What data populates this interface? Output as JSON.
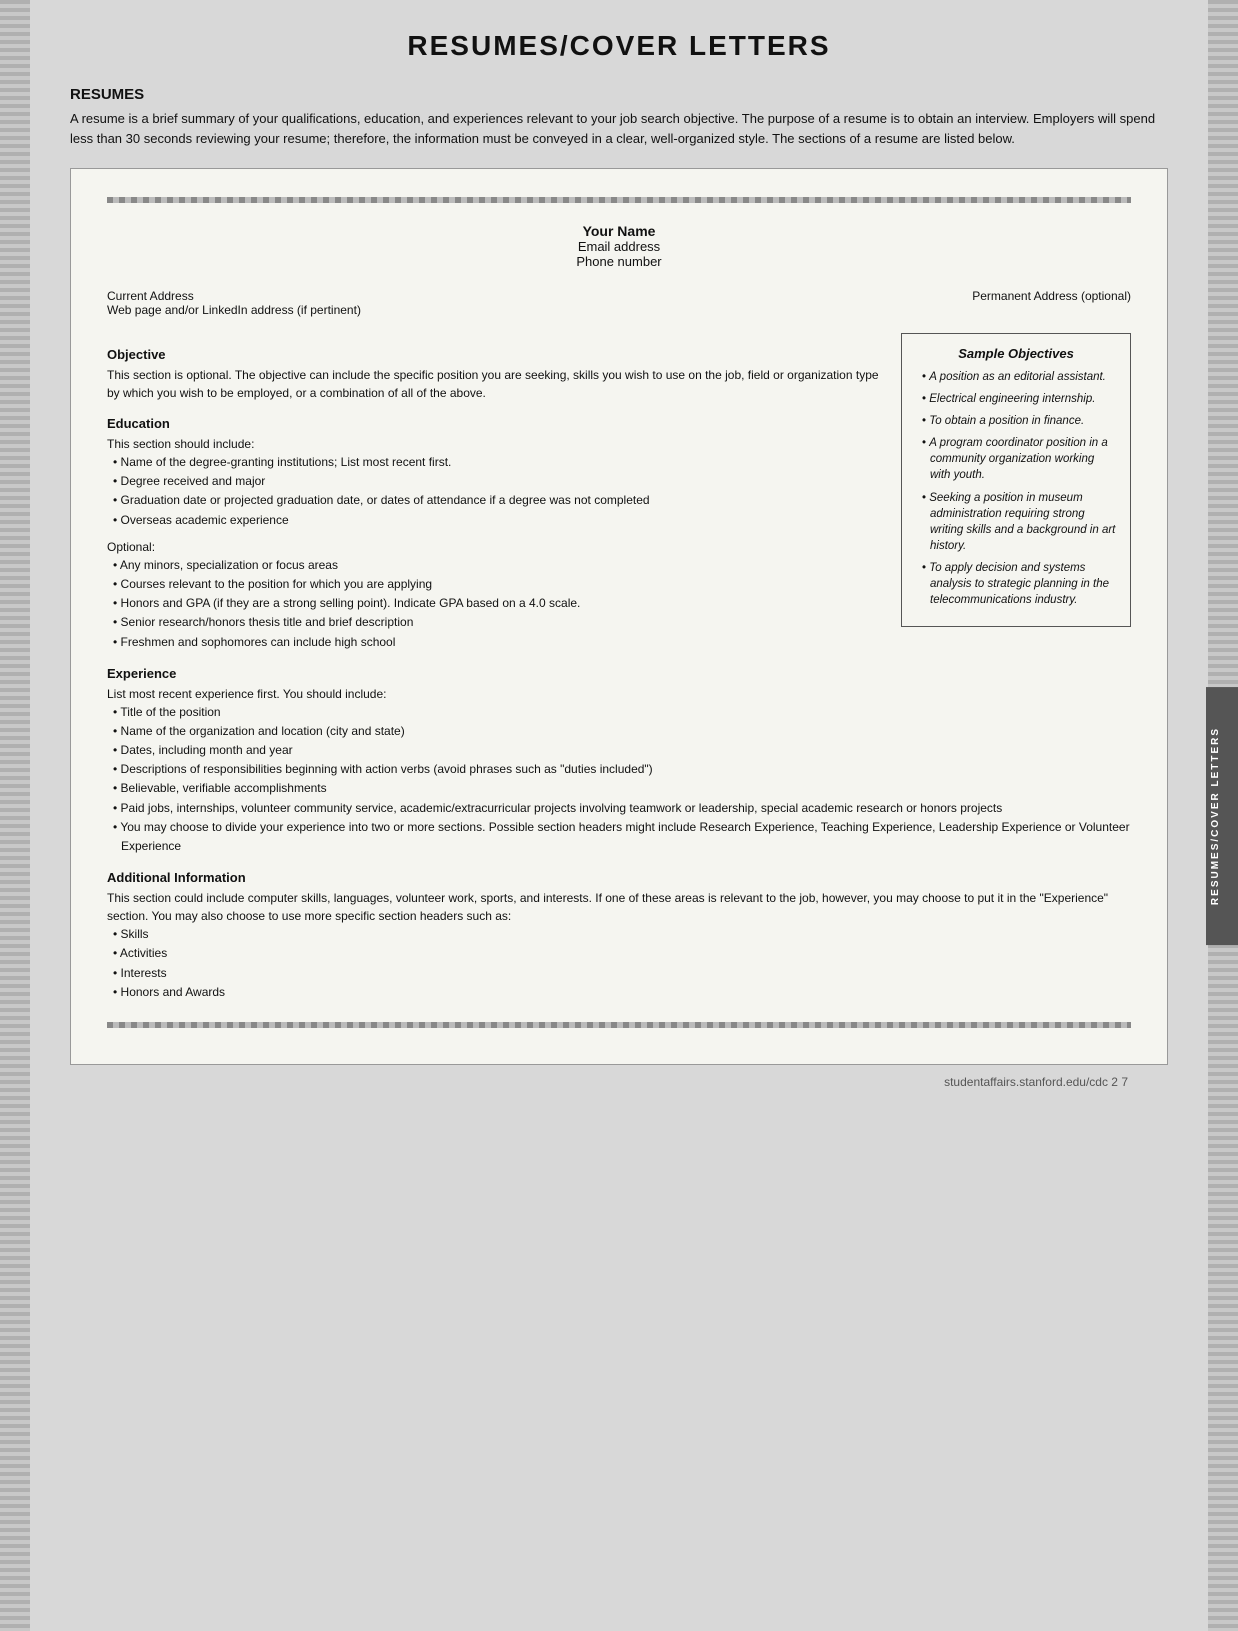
{
  "page": {
    "title": "RESUMES/COVER LETTERS",
    "footer": "studentaffairs.stanford.edu/cdc     2 7"
  },
  "resumes_section": {
    "heading": "RESUMES",
    "intro": "A resume is a brief summary of your qualifications, education, and experiences relevant to your job search objective. The purpose of a resume is to obtain an interview. Employers will spend less than 30 seconds reviewing your resume; therefore, the information must be conveyed in a clear, well-organized style. The sections of a resume are listed below."
  },
  "doc": {
    "your_name": "Your Name",
    "email": "Email address",
    "phone": "Phone number",
    "current_address": "Current Address",
    "web_page": "Web page and/or LinkedIn address (if pertinent)",
    "permanent_address": "Permanent Address (optional)",
    "objective_label": "Objective",
    "objective_text": "This section is optional. The objective can include the specific position you are seeking, skills you wish to use on the job, field or organization type by which you wish to be employed, or a combination of all of the above.",
    "education_label": "Education",
    "education_intro": "This section should include:",
    "education_items": [
      "Name of the degree-granting institutions; List most recent first.",
      "Degree received and major",
      "Graduation date or projected graduation date, or dates of attendance if a degree was not completed",
      "Overseas academic experience"
    ],
    "optional_label": "Optional:",
    "optional_items": [
      "Any minors, specialization or focus areas",
      "Courses relevant to the position for which you are applying",
      "Honors and GPA (if they are a strong selling point). Indicate GPA based on a 4.0 scale.",
      "Senior research/honors thesis title and brief description",
      "Freshmen and sophomores can include high school"
    ],
    "experience_label": "Experience",
    "experience_intro": "List most recent experience first. You should include:",
    "experience_items": [
      "Title of the position",
      "Name of the organization and location (city and state)",
      "Dates, including month and year",
      "Descriptions of responsibilities beginning with action verbs (avoid phrases such as \"duties included\")",
      "Believable, verifiable accomplishments",
      "Paid jobs, internships, volunteer community service, academic/extracurricular projects involving teamwork or leadership, special academic research or honors projects",
      "You may choose to divide your experience into two or more sections. Possible section headers might include Research Experience, Teaching Experience, Leadership Experience or Volunteer Experience"
    ],
    "additional_label": "Additional Information",
    "additional_text": "This section could include computer skills, languages, volunteer work, sports, and interests. If one of these areas is relevant to the job, however, you may choose to put it in the \"Experience\" section. You may also choose to use more specific section headers such as:",
    "additional_items": [
      "Skills",
      "Activities",
      "Interests",
      "Honors and Awards"
    ]
  },
  "sample_objectives": {
    "title": "Sample Objectives",
    "items": [
      "A position as an editorial assistant.",
      "Electrical engineering internship.",
      "To obtain a position in finance.",
      "A program coordinator position in a community organization working with youth.",
      "Seeking a position in museum administration requiring strong writing skills and a background in art history.",
      "To apply decision and systems analysis to strategic planning in the telecommunications industry."
    ]
  },
  "vertical_tab_label": "RESUMES/COVER LETTERS"
}
